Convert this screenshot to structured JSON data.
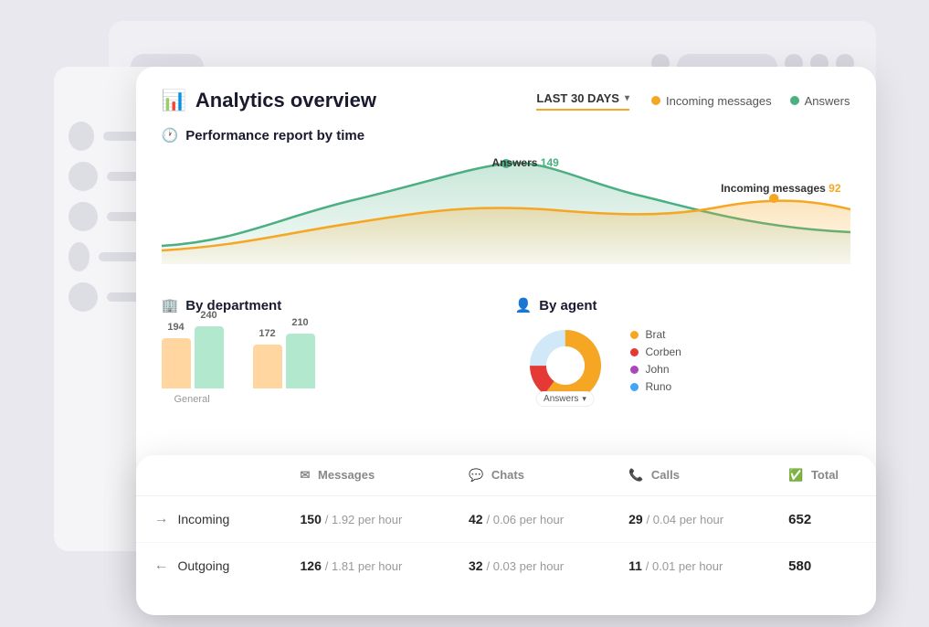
{
  "title": "Analytics overview",
  "dateFilter": {
    "label": "LAST 30 DAYS"
  },
  "legend": {
    "incoming": "Incoming messages",
    "answers": "Answers"
  },
  "performanceSection": {
    "title": "Performance report by time",
    "tooltipAnswers": "Answers",
    "tooltipAnswersValue": "149",
    "tooltipIncoming": "Incoming messages",
    "tooltipIncomingValue": "92"
  },
  "departmentSection": {
    "title": "By department",
    "bars": [
      {
        "label1": "194",
        "label2": "240",
        "deptLabel": "General",
        "h1": 55,
        "h2": 68
      },
      {
        "label1": "172",
        "label2": "210",
        "deptLabel": "",
        "h1": 48,
        "h2": 60
      }
    ]
  },
  "agentSection": {
    "title": "By agent",
    "donutLabel": "Answers",
    "agents": [
      {
        "name": "Brat",
        "color": "#f5a623"
      },
      {
        "name": "Corben",
        "color": "#e53935"
      },
      {
        "name": "John",
        "color": "#ab47bc"
      },
      {
        "name": "Runo",
        "color": "#42a5f5"
      }
    ]
  },
  "table": {
    "headers": [
      {
        "icon": "✉",
        "label": "Messages"
      },
      {
        "icon": "💬",
        "label": "Chats"
      },
      {
        "icon": "📞",
        "label": "Calls"
      },
      {
        "icon": "✅",
        "label": "Total"
      }
    ],
    "rows": [
      {
        "direction": "Incoming",
        "arrowDir": "→",
        "messages": "150",
        "messageRate": "1.92 per hour",
        "chats": "42",
        "chatRate": "0.06 per hour",
        "calls": "29",
        "callRate": "0.04 per hour",
        "total": "652"
      },
      {
        "direction": "Outgoing",
        "arrowDir": "←",
        "messages": "126",
        "messageRate": "1.81 per hour",
        "chats": "32",
        "chatRate": "0.03 per hour",
        "calls": "11",
        "callRate": "0.01 per hour",
        "total": "580"
      }
    ]
  },
  "sidebar": {
    "items": 5
  }
}
